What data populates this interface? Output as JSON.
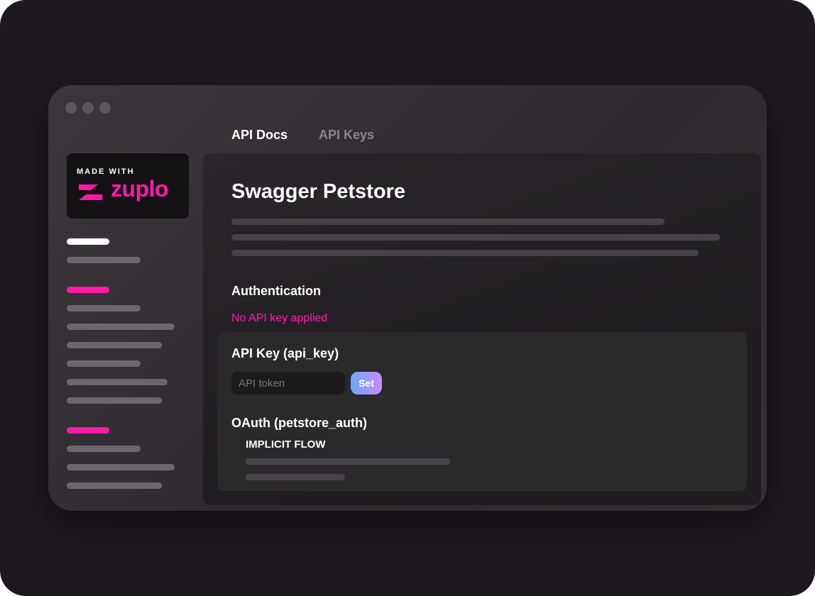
{
  "window": {
    "tabs": [
      {
        "label": "API Docs",
        "active": true
      },
      {
        "label": "API Keys",
        "active": false
      }
    ]
  },
  "logo": {
    "top_text": "MADE WITH",
    "brand": "zuplo",
    "icon": "zuplo-z-icon",
    "brand_color": "#ff1aa8"
  },
  "main": {
    "title": "Swagger Petstore",
    "authentication": {
      "heading": "Authentication",
      "status": "No API key applied",
      "api_key": {
        "heading": "API Key (api_key)",
        "input_placeholder": "API token",
        "input_value": "",
        "button_label": "Set"
      },
      "oauth": {
        "heading": "OAuth (petstore_auth)",
        "flow_label": "IMPLICIT FLOW"
      }
    }
  },
  "colors": {
    "accent": "#ff1aa8",
    "background": "#1f1821",
    "window": "#343035",
    "panel": "#231f24"
  }
}
